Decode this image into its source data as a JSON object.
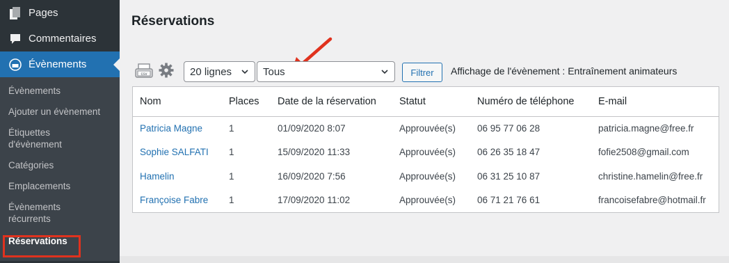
{
  "sidebar": {
    "top_items": [
      {
        "label": "Pages",
        "icon": "pages-icon"
      },
      {
        "label": "Commentaires",
        "icon": "comments-icon"
      },
      {
        "label": "Évènements",
        "icon": "events-icon",
        "active": true
      }
    ],
    "sub_items": [
      {
        "label": "Évènements"
      },
      {
        "label": "Ajouter un évènement"
      },
      {
        "label": "Étiquettes d'évènement"
      },
      {
        "label": "Catégories"
      },
      {
        "label": "Emplacements"
      },
      {
        "label": "Évènements récurrents"
      },
      {
        "label": "Réservations",
        "current": true
      }
    ]
  },
  "main": {
    "title": "Réservations",
    "toolbar": {
      "lines_select": "20 lignes",
      "event_select": "Tous",
      "filter_button": "Filtrer",
      "event_info": "Affichage de l'évènement : Entraînement animateurs"
    },
    "table": {
      "headers": [
        "Nom",
        "Places",
        "Date de la réservation",
        "Statut",
        "Numéro de téléphone",
        "E-mail"
      ],
      "rows": [
        [
          "Patricia Magne",
          "1",
          "01/09/2020 8:07",
          "Approuvée(s)",
          "06 95 77 06 28",
          "patricia.magne@free.fr"
        ],
        [
          "Sophie SALFATI",
          "1",
          "15/09/2020 11:33",
          "Approuvée(s)",
          "06 26 35 18 47",
          "fofie2508@gmail.com"
        ],
        [
          "Hamelin",
          "1",
          "16/09/2020 7:56",
          "Approuvée(s)",
          "06 31 25 10 87",
          "christine.hamelin@free.fr"
        ],
        [
          "Françoise Fabre",
          "1",
          "17/09/2020 11:02",
          "Approuvée(s)",
          "06 71 21 76 61",
          "francoisefabre@hotmail.fr"
        ]
      ]
    }
  },
  "colors": {
    "sidebar_bg": "#2c3338",
    "submenu_bg": "#3c434a",
    "active_blue": "#2271b1",
    "annotation_red": "#e0321e"
  }
}
